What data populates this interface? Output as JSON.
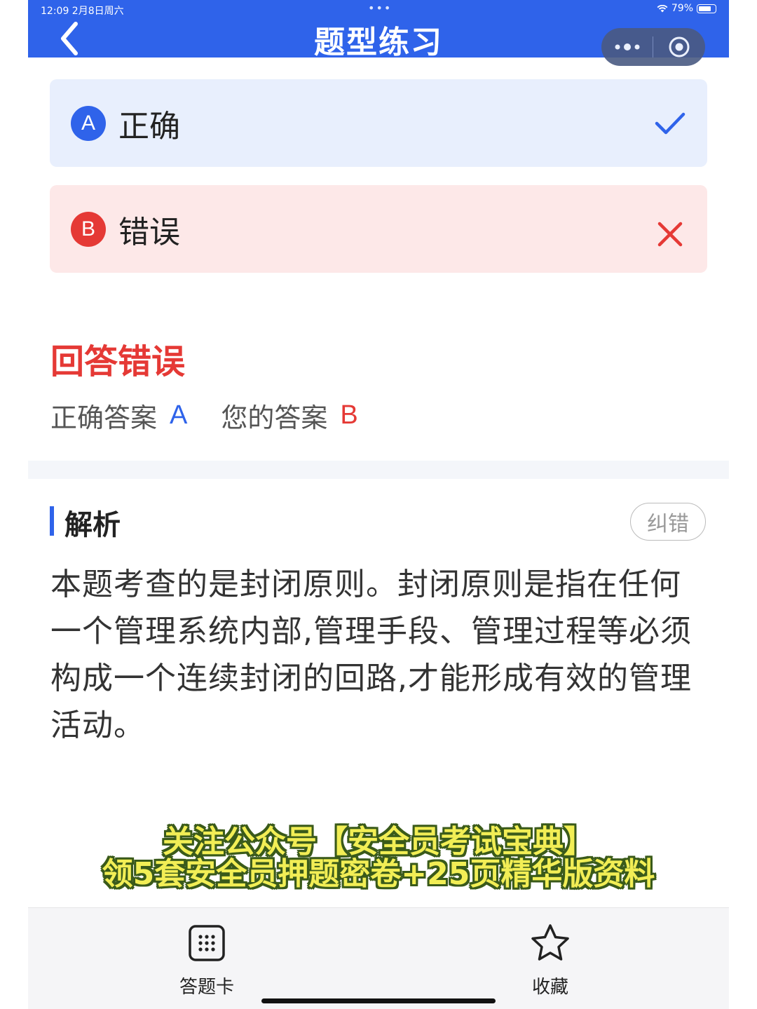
{
  "status_bar": {
    "time": "12:09  2月8日周六",
    "center": "•••",
    "battery": "79%",
    "battery_level": 0.79
  },
  "header": {
    "title": "题型练习",
    "back_icon": "chevron-left-icon",
    "more_icon": "more-dots-icon",
    "close_icon": "target-close-icon"
  },
  "options": [
    {
      "letter": "A",
      "text": "正确",
      "mark": "check-icon",
      "state": "correct"
    },
    {
      "letter": "B",
      "text": "错误",
      "mark": "cross-icon",
      "state": "wrong"
    }
  ],
  "result": {
    "title": "回答错误",
    "correct_label": "正确答案",
    "correct_value": "A",
    "user_label": "您的答案",
    "user_value": "B"
  },
  "analysis": {
    "title": "解析",
    "report_button": "纠错",
    "text": "本题考查的是封闭原则。封闭原则是指在任何一个管理系统内部,管理手段、管理过程等必须构成一个连续封闭的回路,才能形成有效的管理活动。"
  },
  "promo": {
    "line1": "关注公众号【安全员考试宝典】",
    "line2": "领5套安全员押题密卷+25页精华版资料"
  },
  "bottom_bar": {
    "card_label": "答题卡",
    "fav_label": "收藏"
  },
  "colors": {
    "primary": "#2f63ea",
    "error": "#e53935",
    "correct_bg": "#e8effd",
    "wrong_bg": "#fde8e8"
  }
}
